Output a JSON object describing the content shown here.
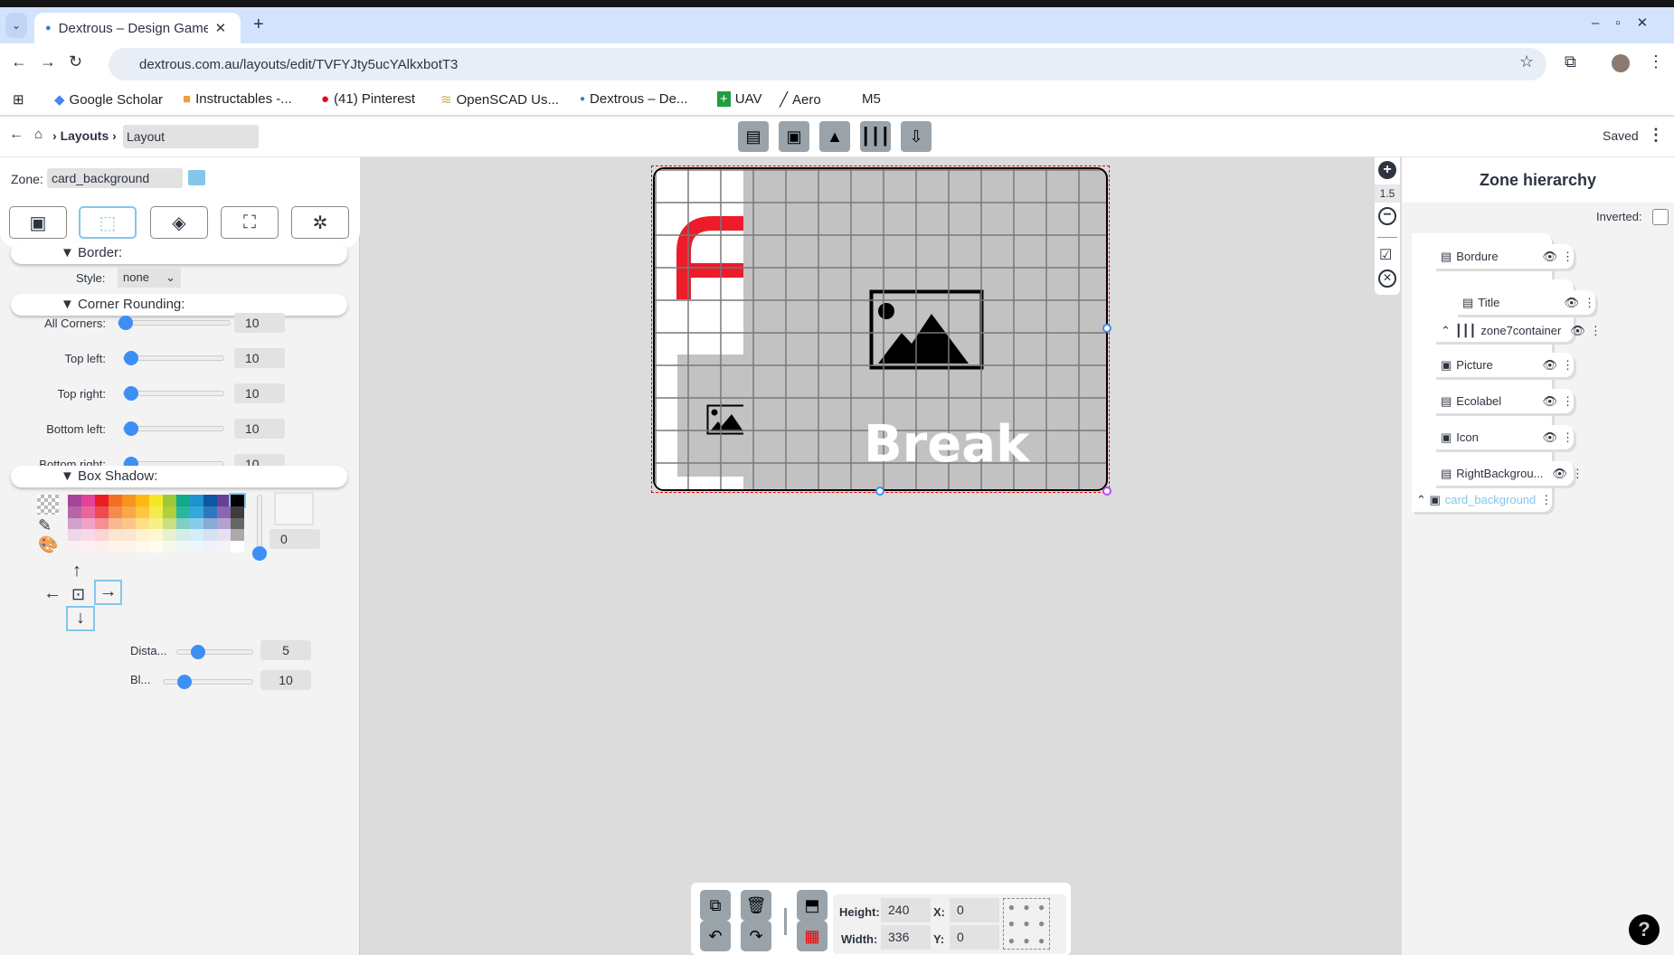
{
  "browser": {
    "tab_title": "Dextrous – Design Game",
    "url": "dextrous.com.au/layouts/edit/TVFYJty5ucYAlkxbotT3",
    "bookmarks": [
      "Google Scholar",
      "Instructables -...",
      "(41) Pinterest",
      "OpenSCAD Us...",
      "Dextrous – De...",
      "UAV",
      "Aero",
      "M5"
    ]
  },
  "app": {
    "breadcrumb": {
      "layouts": "Layouts",
      "current": "Layout"
    },
    "status": "Saved"
  },
  "left": {
    "zone_label": "Zone:",
    "zone_value": "card_background",
    "border": {
      "title": "Border:",
      "style_label": "Style:",
      "style_value": "none"
    },
    "corner": {
      "title": "Corner Rounding:",
      "rows": [
        {
          "label": "All Corners:",
          "value": "10"
        },
        {
          "label": "Top left:",
          "value": "10"
        },
        {
          "label": "Top right:",
          "value": "10"
        },
        {
          "label": "Bottom left:",
          "value": "10"
        },
        {
          "label": "Bottom right:",
          "value": "10"
        }
      ]
    },
    "shadow": {
      "title": "Box Shadow:",
      "opacity": "0",
      "distance_label": "Dista...",
      "distance": "5",
      "blur_label": "Bl...",
      "blur": "10",
      "selected_color": "#000000"
    }
  },
  "canvas": {
    "text": "Break",
    "accent": "#ec1c2a"
  },
  "zoom": {
    "level": "1.5"
  },
  "hierarchy": {
    "title": "Zone hierarchy",
    "inverted_label": "Inverted:",
    "items": [
      "Bordure",
      "Title",
      "zone7container",
      "Picture",
      "Ecolabel",
      "Icon",
      "RightBackgrou...",
      "card_background"
    ]
  },
  "bottom": {
    "height_label": "Height:",
    "height": "240",
    "width_label": "Width:",
    "width": "336",
    "x_label": "X:",
    "x": "0",
    "y_label": "Y:",
    "y": "0"
  }
}
